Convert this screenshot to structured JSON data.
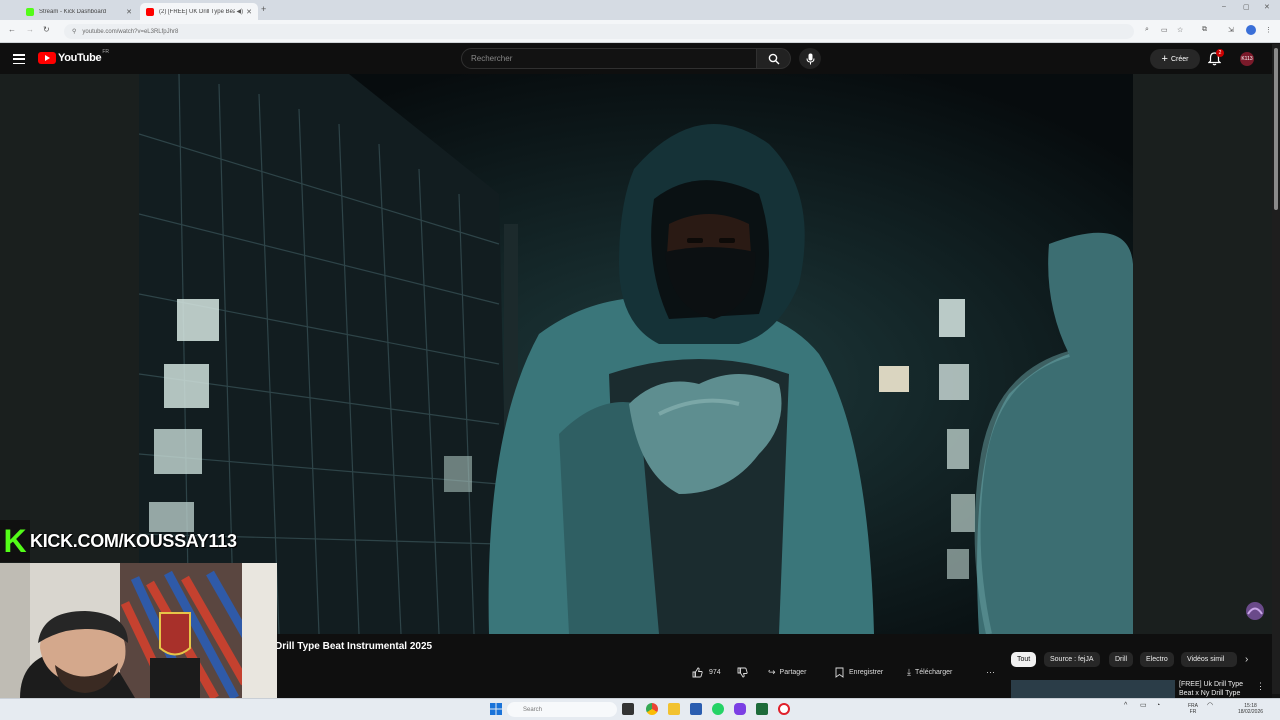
{
  "browser": {
    "tabs": [
      {
        "title": "Stream - Kick Dashboard",
        "favicon_color": "#53fc18",
        "active": false
      },
      {
        "title": "(2) [FREE] UK Drill Type Bea",
        "favicon_color": "#ff0000",
        "active": true
      }
    ],
    "new_tab": "+",
    "url": "youtube.com/watch?v=eL3RLfpJhr8",
    "window_controls": [
      "–",
      "▢",
      "✕"
    ]
  },
  "youtube": {
    "logo_text": "YouTube",
    "country_code": "FR",
    "search_placeholder": "Rechercher",
    "create_label": "Créer",
    "notification_count": "2",
    "avatar_text": "K113"
  },
  "video": {
    "title": "Drill Type Beat Instrumental 2025",
    "likes": "974",
    "share_label": "Partager",
    "save_label": "Enregistrer",
    "download_label": "Télécharger",
    "more_label": "···"
  },
  "chips": [
    {
      "label": "Tout",
      "active": true
    },
    {
      "label": "Source : fejJA",
      "active": false
    },
    {
      "label": "Drill",
      "active": false
    },
    {
      "label": "Electro",
      "active": false
    },
    {
      "label": "Vidéos simil",
      "active": false
    }
  ],
  "recommended": {
    "title": "[FREE] Uk Drill Type Beat x Ny Drill Type"
  },
  "stream_overlay": {
    "kick_logo": "K",
    "kick_text": "KICK.COM/KOUSSAY113"
  },
  "taskbar": {
    "search_placeholder": "Search",
    "language": "FRA",
    "language_sub": "FR",
    "time": "15:18",
    "date": "18/02/2026"
  },
  "colors": {
    "youtube_red": "#ff0000",
    "kick_green": "#53fc18",
    "yt_background": "#0f0f0f"
  }
}
